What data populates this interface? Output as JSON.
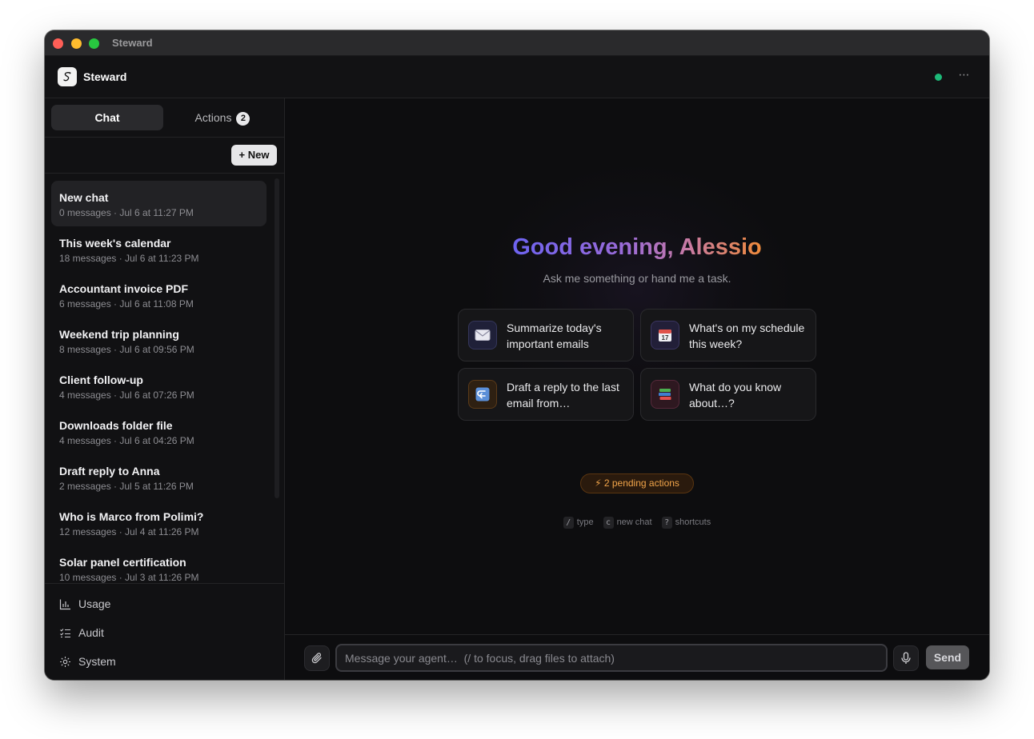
{
  "window": {
    "title": "Steward"
  },
  "header": {
    "app_name": "Steward",
    "status": "online"
  },
  "sidebar": {
    "tabs": [
      {
        "label": "Chat",
        "active": true
      },
      {
        "label": "Actions",
        "badge": "2"
      }
    ],
    "new_button": "+ New",
    "chats": [
      {
        "title": "New chat",
        "meta": "0 messages · Jul 6 at 11:27 PM",
        "selected": true
      },
      {
        "title": "This week's calendar",
        "meta": "18 messages · Jul 6 at 11:23 PM"
      },
      {
        "title": "Accountant invoice PDF",
        "meta": "6 messages · Jul 6 at 11:08 PM"
      },
      {
        "title": "Weekend trip planning",
        "meta": "8 messages · Jul 6 at 09:56 PM"
      },
      {
        "title": "Client follow-up",
        "meta": "4 messages · Jul 6 at 07:26 PM"
      },
      {
        "title": "Downloads folder file",
        "meta": "4 messages · Jul 6 at 04:26 PM"
      },
      {
        "title": "Draft reply to Anna",
        "meta": "2 messages · Jul 5 at 11:26 PM"
      },
      {
        "title": "Who is Marco from Polimi?",
        "meta": "12 messages · Jul 4 at 11:26 PM"
      },
      {
        "title": "Solar panel certification",
        "meta": "10 messages · Jul 3 at 11:26 PM"
      }
    ],
    "nav": [
      {
        "label": "Usage",
        "icon": "bar-chart-icon"
      },
      {
        "label": "Audit",
        "icon": "checklist-icon"
      },
      {
        "label": "System",
        "icon": "gear-icon"
      }
    ]
  },
  "main": {
    "greeting": "Good evening, Alessio",
    "subtitle": "Ask me something or hand me a task.",
    "suggestions": [
      {
        "text": "Summarize today's important emails",
        "icon": "envelope-icon",
        "glyph": "✉️"
      },
      {
        "text": "What's on my schedule this week?",
        "icon": "calendar-icon",
        "glyph": "📅"
      },
      {
        "text": "Draft a reply to the last email from…",
        "icon": "reply-icon",
        "glyph": "↩"
      },
      {
        "text": "What do you know about…?",
        "icon": "books-icon",
        "glyph": "📚"
      }
    ],
    "pending": "⚡ 2 pending actions",
    "hints": [
      {
        "key": "/",
        "label": "type"
      },
      {
        "key": "c",
        "label": "new chat"
      },
      {
        "key": "?",
        "label": "shortcuts"
      }
    ]
  },
  "composer": {
    "placeholder": "Message your agent…  (/ to focus, drag files to attach)",
    "value": "",
    "send_label": "Send"
  },
  "colors": {
    "accent_green": "#1db978",
    "pending_orange": "#f2a54a",
    "gradient_start": "#6d63f0",
    "gradient_end": "#ee8a3a"
  }
}
